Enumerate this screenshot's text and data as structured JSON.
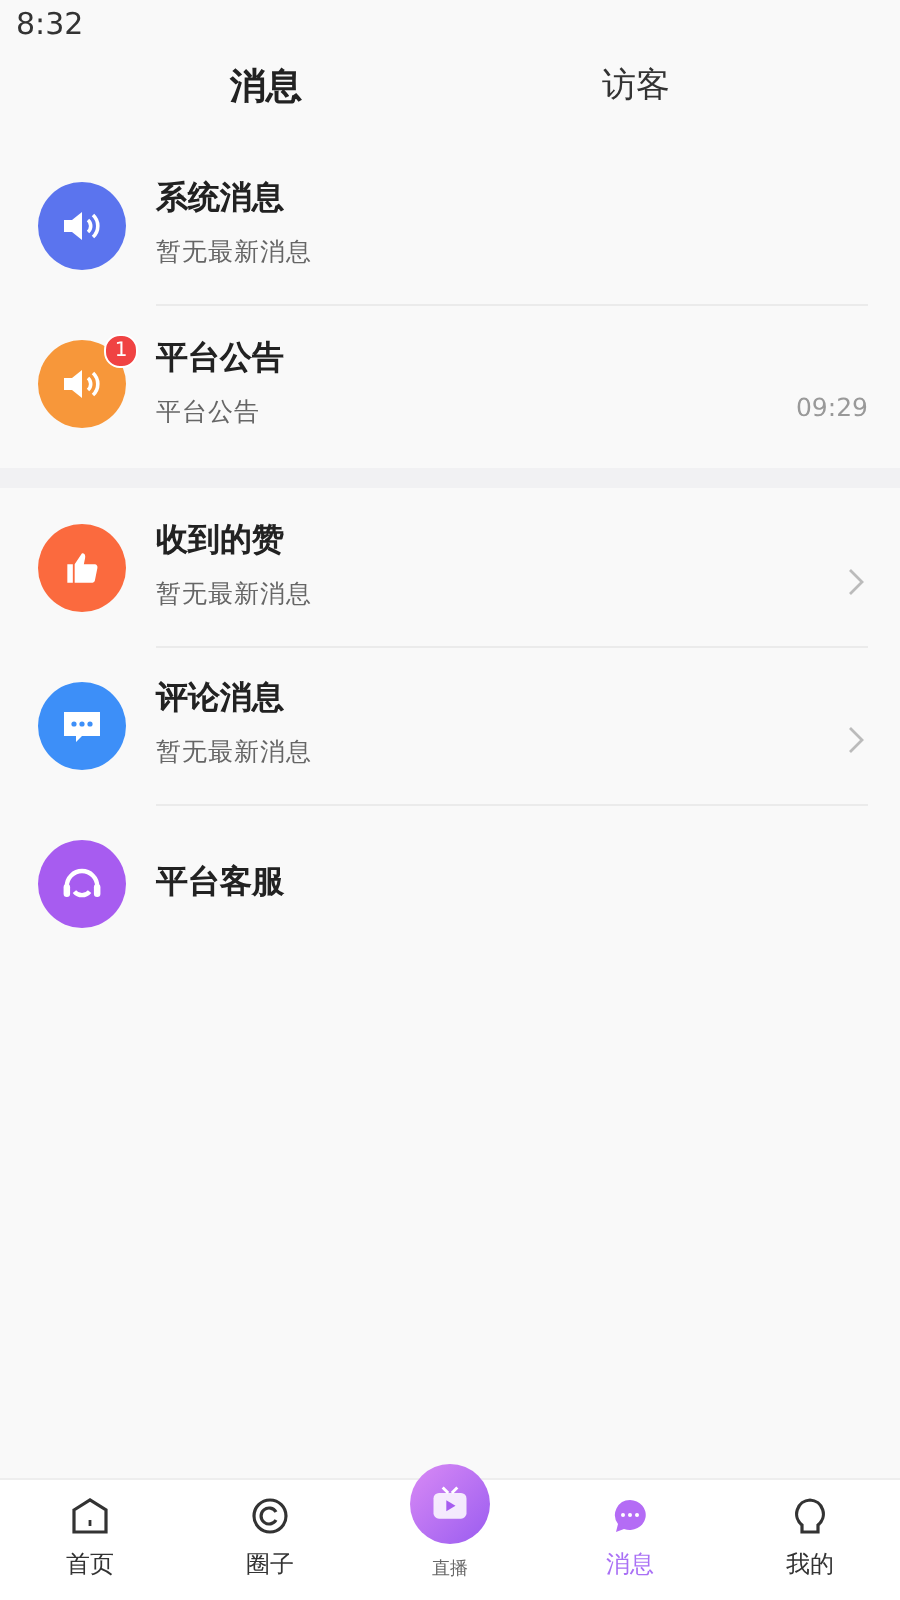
{
  "status_bar": {
    "time": "8:32"
  },
  "tabs": [
    {
      "label": "消息",
      "selected": true
    },
    {
      "label": "访客",
      "selected": false
    }
  ],
  "sections": [
    {
      "items": [
        {
          "kind": "speaker",
          "color": "#5b74ee",
          "title": "系统消息",
          "subtitle": "暂无最新消息",
          "chevron": false
        },
        {
          "kind": "speaker",
          "color": "#f7973a",
          "title": "平台公告",
          "subtitle": "平台公告",
          "time": "09:29",
          "badge": "1",
          "chevron": false
        }
      ]
    },
    {
      "items": [
        {
          "kind": "thumb",
          "color": "#fb6a3e",
          "title": "收到的赞",
          "subtitle": "暂无最新消息",
          "chevron": true
        },
        {
          "kind": "chat",
          "color": "#3d8ff8",
          "title": "评论消息",
          "subtitle": "暂无最新消息",
          "chevron": true
        },
        {
          "kind": "headset",
          "color": "#a75cf0",
          "title": "平台客服",
          "chevron": false
        }
      ]
    }
  ],
  "nav": [
    {
      "kind": "home",
      "label": "首页",
      "selected": false
    },
    {
      "kind": "circle",
      "label": "圈子",
      "selected": false
    },
    {
      "kind": "live",
      "label": "直播",
      "selected": false
    },
    {
      "kind": "chat",
      "label": "消息",
      "selected": true
    },
    {
      "kind": "user",
      "label": "我的",
      "selected": false
    }
  ]
}
